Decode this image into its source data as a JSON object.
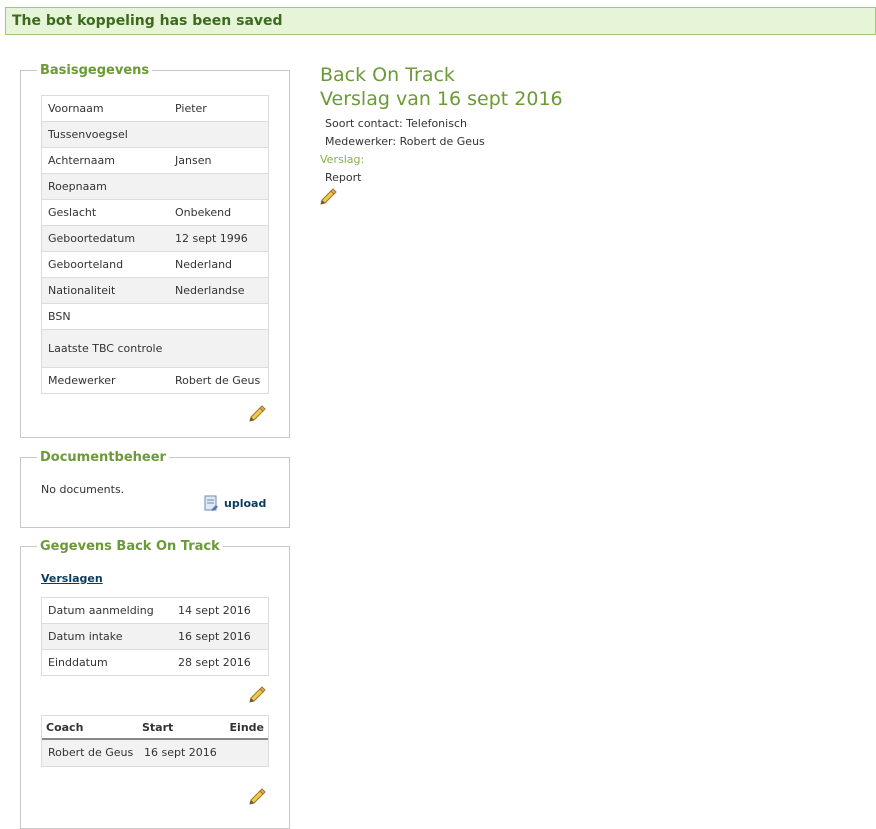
{
  "flash": {
    "message": "The bot koppeling has been saved"
  },
  "basis": {
    "legend": "Basisgegevens",
    "rows": [
      {
        "label": "Voornaam",
        "value": "Pieter"
      },
      {
        "label": "Tussenvoegsel",
        "value": ""
      },
      {
        "label": "Achternaam",
        "value": "Jansen"
      },
      {
        "label": "Roepnaam",
        "value": ""
      },
      {
        "label": "Geslacht",
        "value": "Onbekend"
      },
      {
        "label": "Geboortedatum",
        "value": "12 sept 1996"
      },
      {
        "label": "Geboorteland",
        "value": "Nederland"
      },
      {
        "label": "Nationaliteit",
        "value": "Nederlandse"
      },
      {
        "label": "BSN",
        "value": ""
      },
      {
        "label": "Laatste TBC controle",
        "value": ""
      },
      {
        "label": "Medewerker",
        "value": "Robert de Geus"
      }
    ]
  },
  "documents": {
    "legend": "Documentbeheer",
    "empty_text": "No documents.",
    "upload_label": "upload"
  },
  "track": {
    "legend": "Gegevens Back On Track",
    "link_label": "Verslagen",
    "rows": [
      {
        "label": "Datum aanmelding",
        "value": "14 sept 2016"
      },
      {
        "label": "Datum intake",
        "value": "16 sept 2016"
      },
      {
        "label": "Einddatum",
        "value": "28 sept 2016"
      }
    ],
    "coach_headers": {
      "coach": "Coach",
      "start": "Start",
      "end": "Einde"
    },
    "coach_rows": [
      {
        "coach": "Robert de Geus",
        "start": "16 sept 2016",
        "end": ""
      }
    ]
  },
  "report": {
    "title": "Back On Track",
    "subtitle": "Verslag van 16 sept 2016",
    "contact_type": "Soort contact: Telefonisch",
    "employee": "Medewerker: Robert de Geus",
    "verslag_label": "Verslag:",
    "verslag_text": "Report"
  },
  "icons": {
    "edit": "pencil-icon",
    "upload": "document-upload-icon"
  },
  "colors": {
    "accent": "#6b9a36",
    "flash_bg": "#e6f4d7",
    "link": "#0b3c5d"
  }
}
